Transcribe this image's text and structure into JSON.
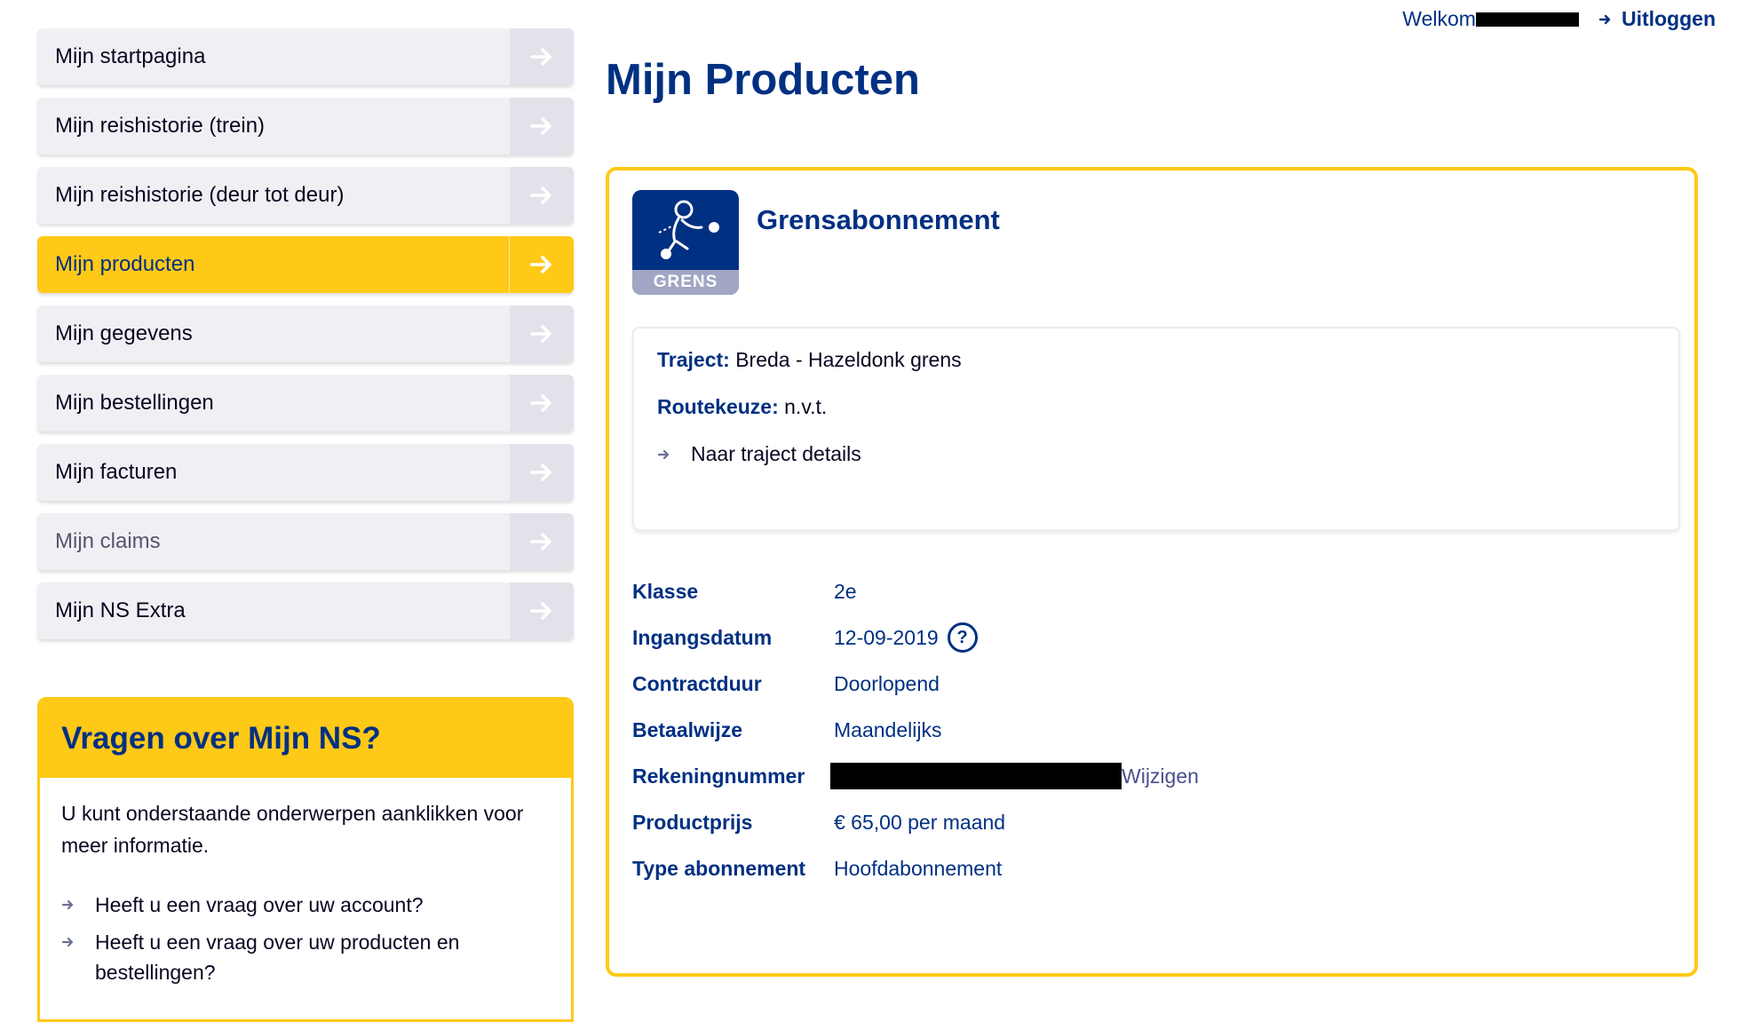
{
  "header": {
    "welcome_prefix": "Welkom",
    "logout_label": "Uitloggen"
  },
  "sidebar": {
    "items": [
      {
        "label": "Mijn startpagina"
      },
      {
        "label": "Mijn reishistorie (trein)"
      },
      {
        "label": "Mijn reishistorie (deur tot deur)"
      },
      {
        "label": "Mijn producten"
      },
      {
        "label": "Mijn gegevens"
      },
      {
        "label": "Mijn bestellingen"
      },
      {
        "label": "Mijn facturen"
      },
      {
        "label": "Mijn claims"
      },
      {
        "label": "Mijn NS Extra"
      }
    ],
    "active_index": 3
  },
  "help": {
    "title": "Vragen over Mijn NS?",
    "intro": "U kunt onderstaande onderwerpen aanklikken voor meer informatie.",
    "links": [
      {
        "label": "Heeft u een vraag over uw account?"
      },
      {
        "label": "Heeft u een vraag over uw producten en bestellingen?"
      }
    ]
  },
  "page": {
    "title": "Mijn Producten"
  },
  "product": {
    "logo_text": "GRENS",
    "name": "Grensabonnement",
    "traject_label": "Traject:",
    "traject_value": "Breda - Hazeldonk grens",
    "routekeuze_label": "Routekeuze:",
    "routekeuze_value": "n.v.t.",
    "details_link": "Naar traject details",
    "details": {
      "klasse": {
        "label": "Klasse",
        "value": "2e"
      },
      "ingangsdatum": {
        "label": "Ingangsdatum",
        "value": "12-09-2019"
      },
      "contractduur": {
        "label": "Contractduur",
        "value": "Doorlopend"
      },
      "betaalwijze": {
        "label": "Betaalwijze",
        "value": "Maandelijks"
      },
      "rekeningnummer": {
        "label": "Rekeningnummer",
        "action": "Wijzigen"
      },
      "productprijs": {
        "label": "Productprijs",
        "value": "€ 65,00 per maand"
      },
      "type": {
        "label": "Type abonnement",
        "value": "Hoofdabonnement"
      }
    }
  },
  "colors": {
    "ns_blue": "#003082",
    "ns_yellow": "#ffc917"
  }
}
